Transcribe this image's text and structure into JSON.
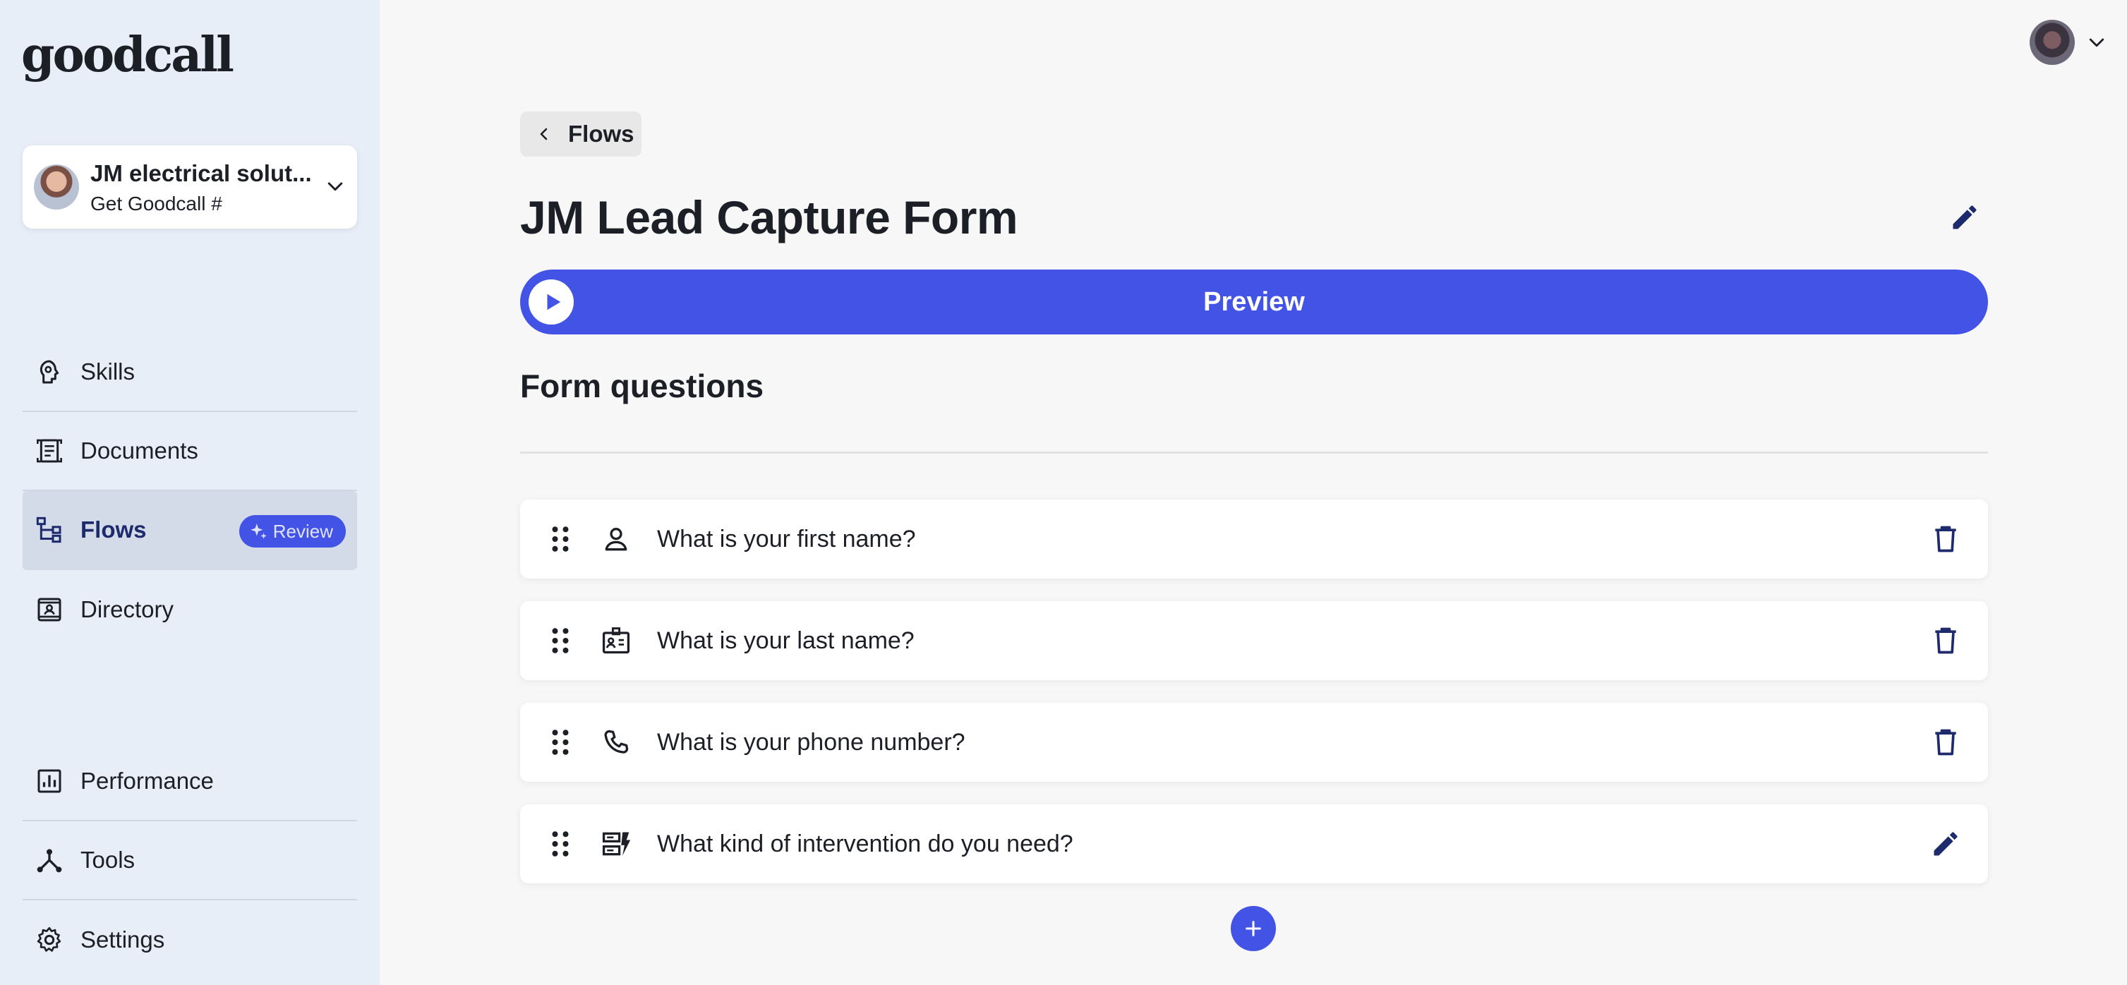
{
  "brand": {
    "logo_text": "goodcall"
  },
  "account": {
    "name": "JM electrical solut...",
    "subtitle": "Get Goodcall #"
  },
  "sidebar": {
    "nav_top": [
      {
        "label": "Skills",
        "icon": "brain-icon"
      },
      {
        "label": "Documents",
        "icon": "document-icon"
      },
      {
        "label": "Flows",
        "icon": "flow-icon",
        "active": true,
        "badge": "Review"
      },
      {
        "label": "Directory",
        "icon": "contact-book-icon"
      }
    ],
    "nav_bottom": [
      {
        "label": "Performance",
        "icon": "bar-chart-icon"
      },
      {
        "label": "Tools",
        "icon": "tools-icon"
      },
      {
        "label": "Settings",
        "icon": "gear-icon"
      }
    ]
  },
  "header": {
    "back_label": "Flows",
    "title": "JM Lead Capture Form"
  },
  "preview": {
    "label": "Preview"
  },
  "form": {
    "section_title": "Form questions",
    "questions": [
      {
        "text": "What is your first name?",
        "icon": "person-icon",
        "action": "delete"
      },
      {
        "text": "What is your last name?",
        "icon": "id-card-icon",
        "action": "delete"
      },
      {
        "text": "What is your phone number?",
        "icon": "phone-icon",
        "action": "delete"
      },
      {
        "text": "What kind of intervention do you need?",
        "icon": "service-icon",
        "action": "edit"
      }
    ]
  },
  "colors": {
    "accent": "#4353e6",
    "sidebar_bg": "#e8eef8",
    "page_bg": "#f7f7f7",
    "active_nav_bg": "#d3dbe8"
  }
}
